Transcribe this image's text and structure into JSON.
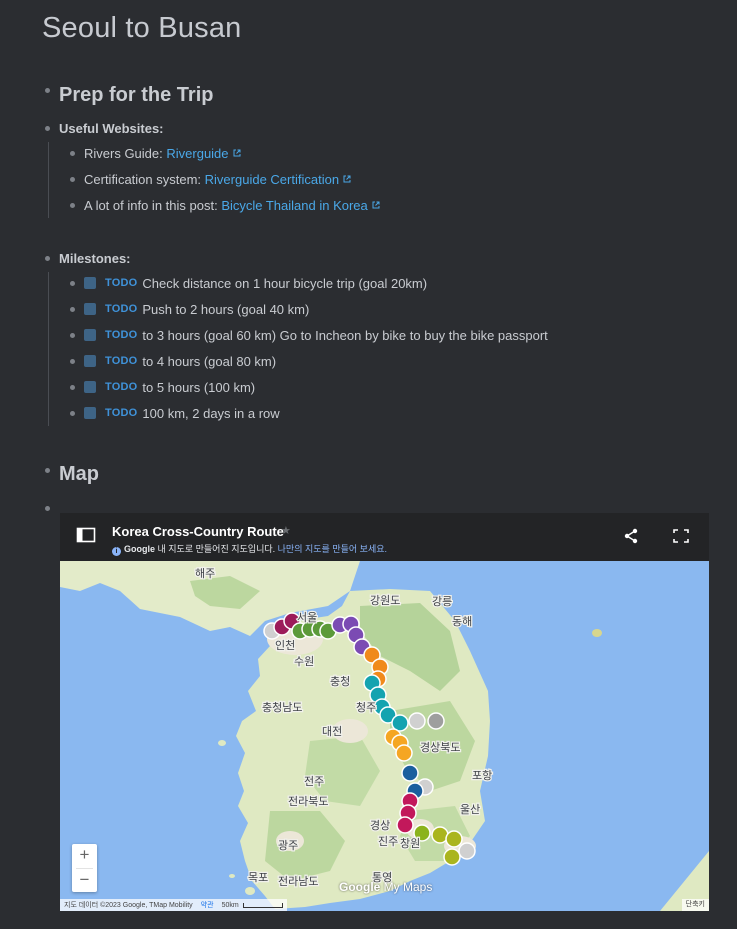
{
  "page": {
    "title": "Seoul to Busan"
  },
  "prep": {
    "heading": "Prep for the Trip",
    "websites": {
      "label": "Useful Websites:",
      "items": [
        {
          "prefix": "Rivers Guide: ",
          "link": "Riverguide"
        },
        {
          "prefix": "Certification system: ",
          "link": "Riverguide Certification"
        },
        {
          "prefix": "A lot of info in this post: ",
          "link": "Bicycle Thailand in Korea"
        }
      ]
    },
    "milestones": {
      "label": "Milestones:",
      "items": [
        {
          "marker": "TODO",
          "text": "Check distance on 1 hour bicycle trip (goal 20km)"
        },
        {
          "marker": "TODO",
          "text": "Push to 2 hours (goal 40 km)"
        },
        {
          "marker": "TODO",
          "text": "to 3 hours (goal 60 km) Go to Incheon by bike to buy the bike passport"
        },
        {
          "marker": "TODO",
          "text": "to 4 hours (goal 80 km)"
        },
        {
          "marker": "TODO",
          "text": "to 5 hours (100 km)"
        },
        {
          "marker": "TODO",
          "text": "100 km, 2 days in a row"
        }
      ]
    }
  },
  "map_section": {
    "heading": "Map"
  },
  "map": {
    "title": "Korea Cross-Country Route",
    "subtitle_brand": "Google",
    "subtitle_text": " 내 지도로 만들어진 지도입니다. ",
    "subtitle_link": "나만의 지도를 만들어 보세요.",
    "zoom_in": "+",
    "zoom_out": "−",
    "attribution": "지도 데이터 ©2023 Google, TMap Mobility",
    "terms": "약관",
    "scale": "50km",
    "shortcuts": "단축키",
    "watermark_brand": "Google",
    "watermark_suffix": " My Maps",
    "labels": {
      "haeju": "해주",
      "seoul": "서울",
      "incheon": "인천",
      "gangwon": "강원도",
      "gangneung": "강릉",
      "donghae": "동해",
      "suwon": "수원",
      "chungcheong": "충청",
      "chungnam": "충청남도",
      "cheongju": "청주",
      "daejeon": "대전",
      "gyeongbuk": "경상북도",
      "pohang": "포항",
      "jeonju": "전주",
      "jeonbuk": "전라북도",
      "gyeongsang": "경상",
      "ulsan": "울산",
      "gwangju": "광주",
      "jinju": "진주",
      "mokpo": "목포",
      "jeonnam": "전라남도",
      "tongyeong": "통영",
      "changwon": "창원"
    },
    "colors": {
      "water": "#8ab8f0",
      "land": "#dfe9c2",
      "forest": "#b5d39a",
      "urban": "#ece7d8"
    }
  }
}
